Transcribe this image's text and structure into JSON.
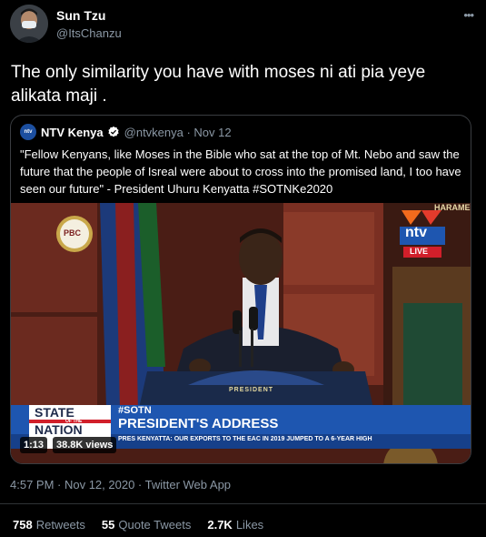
{
  "author": {
    "name": "Sun Tzu",
    "handle": "@ItsChanzu"
  },
  "tweet": {
    "text": "The only similarity you have with moses ni ati pia yeye alikata maji ."
  },
  "quoted": {
    "avatar_label": "ntv",
    "name": "NTV Kenya",
    "handle_date": "@ntvkenya · Nov 12",
    "text": "\"Fellow Kenyans, like Moses in the Bible who sat at the top of Mt. Nebo and saw the future that the people of Isreal were about to cross into the promised land, I too have seen our future\" - President Uhuru Kenyatta #SOTNKe2020",
    "video": {
      "pbc_label": "PBC",
      "harambee": "HARAME",
      "ntv_logo": "ntv",
      "live": "LIVE",
      "podium_seal": "PRESIDENT",
      "state": "STATE",
      "of_the": "OF THE",
      "nation": "NATION",
      "tag": "#SOTN",
      "headline": "PRESIDENT'S ADDRESS",
      "ticker": "PRES KENYATTA: OUR EXPORTS TO THE EAC IN 2019 JUMPED TO A 6-YEAR HIGH",
      "duration": "1:13",
      "views": "38.8K views"
    }
  },
  "meta": {
    "timestamp": "4:57 PM · Nov 12, 2020 · Twitter Web App"
  },
  "stats": [
    {
      "count": "758",
      "label": "Retweets"
    },
    {
      "count": "55",
      "label": "Quote Tweets"
    },
    {
      "count": "2.7K",
      "label": "Likes"
    }
  ],
  "colors": {
    "background": "#000000",
    "secondary_text": "#8b98a5",
    "verified": "#1d9bf0",
    "banner_blue": "#1e56b0"
  }
}
